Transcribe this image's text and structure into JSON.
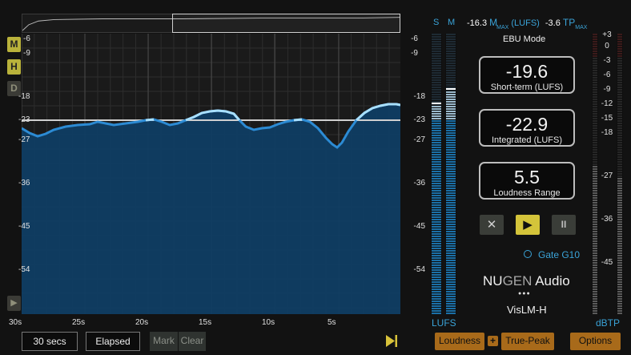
{
  "header": {
    "s_label": "S",
    "m_label": "M",
    "m_max_value": "-16.3",
    "m_max_label": "M",
    "max_sub": "MAX",
    "lufs_unit": "(LUFS)",
    "tp_max_value": "-3.6",
    "tp_label": "TP",
    "tp_max_sub": "MAX",
    "mode": "EBU Mode"
  },
  "side_buttons": {
    "m": "M",
    "h": "H",
    "d": "D"
  },
  "graph": {
    "y_labels": [
      "-6",
      "-9",
      "-18",
      "-23",
      "-27",
      "-36",
      "-45",
      "-54"
    ],
    "x_labels": [
      "30s",
      "25s",
      "20s",
      "15s",
      "10s",
      "5s"
    ]
  },
  "meter": {
    "y_labels": [
      "-6",
      "-9",
      "-18",
      "-23",
      "-27",
      "-36",
      "-45",
      "-54"
    ],
    "unit": "LUFS"
  },
  "readouts": {
    "short_term": {
      "value": "-19.6",
      "label": "Short-term (LUFS)"
    },
    "integrated": {
      "value": "-22.9",
      "label": "Integrated (LUFS)"
    },
    "range": {
      "value": "5.5",
      "label": "Loudness Range"
    }
  },
  "transport": {
    "reset": "✕",
    "play": "▶",
    "pause": "II"
  },
  "gate": {
    "label": "Gate G10"
  },
  "brand": {
    "nu": "NU",
    "gen": "GEN",
    "audio": " Audio",
    "dots": "●●●",
    "product": "VisLM-H"
  },
  "tp_meter": {
    "labels": [
      "+3",
      "0",
      "-3",
      "-6",
      "-9",
      "-12",
      "-15",
      "-18",
      "-27",
      "-36",
      "-45"
    ],
    "unit": "dBTP"
  },
  "bottom": {
    "duration": "30 secs",
    "elapsed": "Elapsed",
    "mark": "Mark",
    "clear": "Clear",
    "loudness": "Loudness",
    "plus": "+",
    "true_peak": "True-Peak",
    "options": "Options"
  },
  "colors": {
    "accent": "#b9b23b",
    "blue": "#3aa3d8",
    "orange": "#a86a1a"
  }
}
